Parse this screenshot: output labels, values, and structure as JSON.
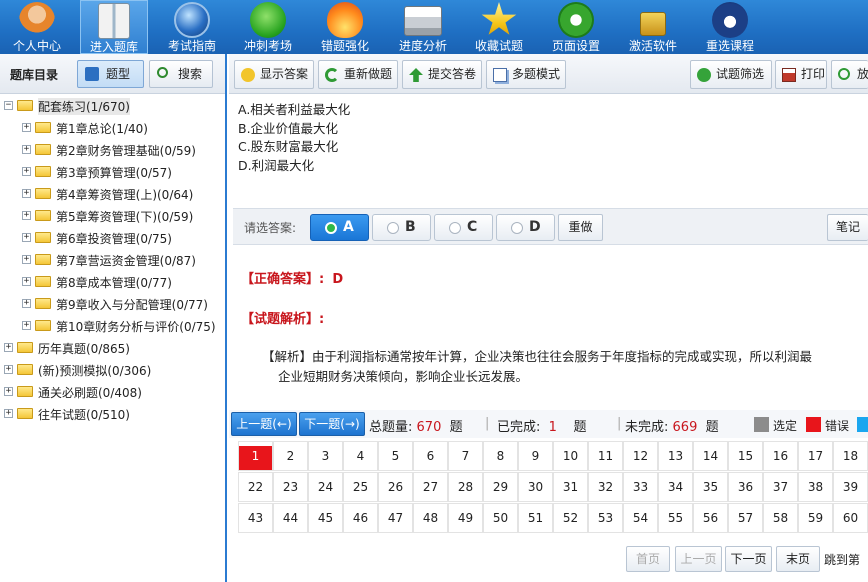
{
  "nav": [
    {
      "label": "个人中心",
      "icon": "user-icon"
    },
    {
      "label": "进入题库",
      "icon": "book-icon"
    },
    {
      "label": "考试指南",
      "icon": "globe-icon"
    },
    {
      "label": "冲刺考场",
      "icon": "runner-icon"
    },
    {
      "label": "错题强化",
      "icon": "flame-icon"
    },
    {
      "label": "进度分析",
      "icon": "printer-icon"
    },
    {
      "label": "收藏试题",
      "icon": "star-icon"
    },
    {
      "label": "页面设置",
      "icon": "gear-icon"
    },
    {
      "label": "激活软件",
      "icon": "lock-icon"
    },
    {
      "label": "重选课程",
      "icon": "home-icon"
    }
  ],
  "left": {
    "title": "题库目录",
    "type_btn": "题型",
    "search_btn": "搜索",
    "tree": [
      {
        "label": "配套练习(1/670)",
        "toggle": "−"
      },
      {
        "label": "第1章总论(1/40)",
        "toggle": "+"
      },
      {
        "label": "第2章财务管理基础(0/59)",
        "toggle": "+"
      },
      {
        "label": "第3章预算管理(0/57)",
        "toggle": "+"
      },
      {
        "label": "第4章筹资管理(上)(0/64)",
        "toggle": "+"
      },
      {
        "label": "第5章筹资管理(下)(0/59)",
        "toggle": "+"
      },
      {
        "label": "第6章投资管理(0/75)",
        "toggle": "+"
      },
      {
        "label": "第7章营运资金管理(0/87)",
        "toggle": "+"
      },
      {
        "label": "第8章成本管理(0/77)",
        "toggle": "+"
      },
      {
        "label": "第9章收入与分配管理(0/77)",
        "toggle": "+"
      },
      {
        "label": "第10章财务分析与评价(0/75)",
        "toggle": "+"
      },
      {
        "label": "历年真题(0/865)",
        "toggle": "+"
      },
      {
        "label": "(新)预测模拟(0/306)",
        "toggle": "+"
      },
      {
        "label": "通关必刷题(0/408)",
        "toggle": "+"
      },
      {
        "label": "往年试题(0/510)",
        "toggle": "+"
      }
    ]
  },
  "toolbar": {
    "show_answer": "显示答案",
    "redo": "重新做题",
    "submit": "提交答卷",
    "multi": "多题模式",
    "filter": "试题筛选",
    "print": "打印",
    "zoom": "放"
  },
  "question": {
    "options": [
      "A.相关者利益最大化",
      "B.企业价值最大化",
      "C.股东财富最大化",
      "D.利润最大化"
    ]
  },
  "answer_bar": {
    "label": "请选答案:",
    "options": [
      "A",
      "B",
      "C",
      "D"
    ],
    "selected": "A",
    "redo": "重做",
    "notes": "笔记"
  },
  "analysis": {
    "correct_label": "【正确答案】:",
    "correct_value": "D",
    "analysis_label": "【试题解析】:",
    "text_line1": "【解析】由于利润指标通常按年计算，企业决策也往往会服务于年度指标的完成或实现，所以利润最",
    "text_line2": "企业短期财务决策倾向，影响企业长远发展。"
  },
  "navbar": {
    "prev": "上一题(←)",
    "next": "下一题(→)",
    "total_label": "总题量:",
    "total": "670",
    "unit1": "题",
    "done_label": "已完成:",
    "done": "1",
    "unit2": "题",
    "todo_label": "未完成:",
    "todo": "669",
    "unit3": "题",
    "legend_selected": "选定",
    "legend_wrong": "错误",
    "color_selected": "#8c8c8c",
    "color_wrong": "#e8151b",
    "color_right": "#1aa6ef"
  },
  "grid": {
    "rows": [
      [
        "1",
        "2",
        "3",
        "4",
        "5",
        "6",
        "7",
        "8",
        "9",
        "10",
        "11",
        "12",
        "13",
        "14",
        "15",
        "16",
        "17",
        "18"
      ],
      [
        "22",
        "23",
        "24",
        "25",
        "26",
        "27",
        "28",
        "29",
        "30",
        "31",
        "32",
        "33",
        "34",
        "35",
        "36",
        "37",
        "38",
        "39"
      ],
      [
        "43",
        "44",
        "45",
        "46",
        "47",
        "48",
        "49",
        "50",
        "51",
        "52",
        "53",
        "54",
        "55",
        "56",
        "57",
        "58",
        "59",
        "60"
      ]
    ]
  },
  "pager": {
    "first": "首页",
    "prev": "上一页",
    "next": "下一页",
    "last": "末页",
    "jump": "跳到第"
  }
}
